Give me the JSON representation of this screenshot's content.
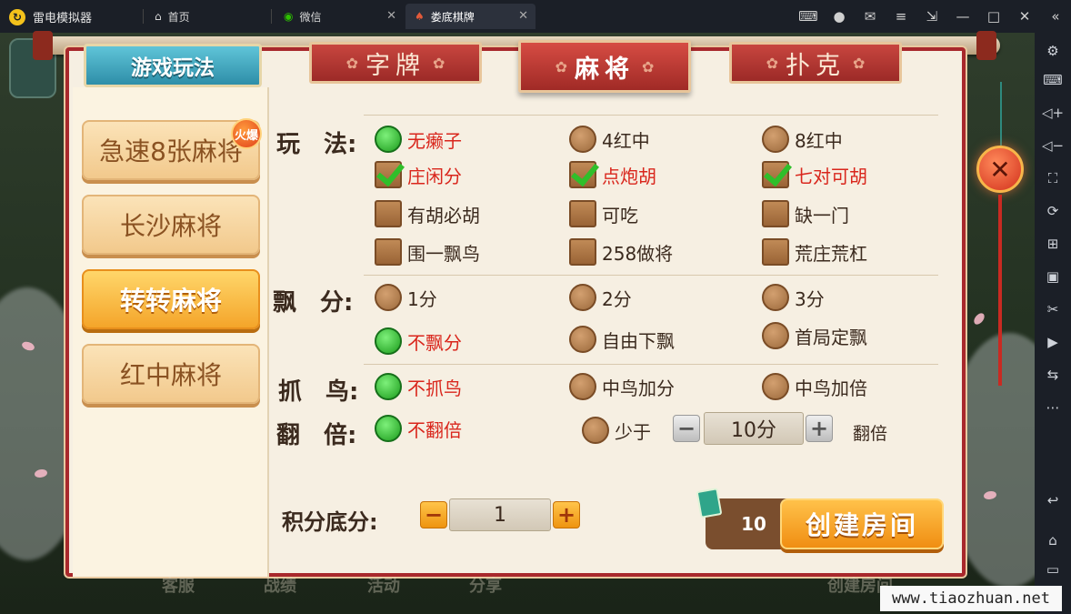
{
  "titlebar": {
    "app_name": "雷电模拟器",
    "tabs": [
      {
        "label": "首页",
        "icon": "home-icon"
      },
      {
        "label": "微信",
        "icon": "wechat-icon"
      },
      {
        "label": "娄底棋牌",
        "icon": "game-icon"
      }
    ],
    "window_icons": [
      "gamepad-icon",
      "user-icon",
      "mail-icon",
      "menu-icon",
      "pin-icon",
      "minimize-icon",
      "maximize-icon",
      "close-icon",
      "collapse-icon"
    ]
  },
  "sidebar": {
    "icons": [
      "settings-icon",
      "keyboard-icon",
      "volume-up-icon",
      "volume-down-icon",
      "fullscreen-icon",
      "rotate-icon",
      "add-icon",
      "apk-icon",
      "scissors-icon",
      "video-icon",
      "sync-icon",
      "more-icon",
      "back-icon",
      "home-icon",
      "recent-icon"
    ]
  },
  "panel": {
    "rules_tab": "游戏玩法",
    "categories": [
      "字牌",
      "麻将",
      "扑克"
    ],
    "active_category": "麻将",
    "hot_badge": "火爆",
    "games": [
      "急速8张麻将",
      "长沙麻将",
      "转转麻将",
      "红中麻将"
    ],
    "selected_game": "转转麻将",
    "rows": {
      "play": {
        "label": "玩　法:",
        "options": [
          {
            "text": "无癞子",
            "kind": "radio",
            "checked": true
          },
          {
            "text": "4红中",
            "kind": "radio",
            "checked": false
          },
          {
            "text": "8红中",
            "kind": "radio",
            "checked": false
          },
          {
            "text": "庄闲分",
            "kind": "check",
            "checked": true
          },
          {
            "text": "点炮胡",
            "kind": "check",
            "checked": true
          },
          {
            "text": "七对可胡",
            "kind": "check",
            "checked": true
          },
          {
            "text": "有胡必胡",
            "kind": "check",
            "checked": false
          },
          {
            "text": "可吃",
            "kind": "check",
            "checked": false
          },
          {
            "text": "缺一门",
            "kind": "check",
            "checked": false
          },
          {
            "text": "围一飘鸟",
            "kind": "check",
            "checked": false
          },
          {
            "text": "258做将",
            "kind": "check",
            "checked": false
          },
          {
            "text": "荒庄荒杠",
            "kind": "check",
            "checked": false
          }
        ]
      },
      "piao": {
        "label": "飘　分:",
        "options": [
          {
            "text": "1分",
            "checked": false
          },
          {
            "text": "2分",
            "checked": false
          },
          {
            "text": "3分",
            "checked": false
          },
          {
            "text": "不飘分",
            "checked": true
          },
          {
            "text": "自由下飘",
            "checked": false
          },
          {
            "text": "首局定飘",
            "checked": false
          }
        ]
      },
      "bird": {
        "label": "抓　鸟:",
        "options": [
          {
            "text": "不抓鸟",
            "checked": true
          },
          {
            "text": "中鸟加分",
            "checked": false
          },
          {
            "text": "中鸟加倍",
            "checked": false
          }
        ]
      },
      "double": {
        "label": "翻　倍:",
        "options": [
          {
            "text": "不翻倍",
            "checked": true
          },
          {
            "text": "少于",
            "checked": false
          }
        ],
        "stepper_value": "10分",
        "suffix": "翻倍"
      }
    },
    "base_score": {
      "label": "积分底分:",
      "value": "1"
    },
    "room_cost": "10",
    "create_button": "创建房间",
    "bottom_hints": [
      "客服",
      "战绩",
      "活动",
      "分享",
      "创建房间"
    ]
  },
  "watermark": "www.tiaozhuan.net"
}
